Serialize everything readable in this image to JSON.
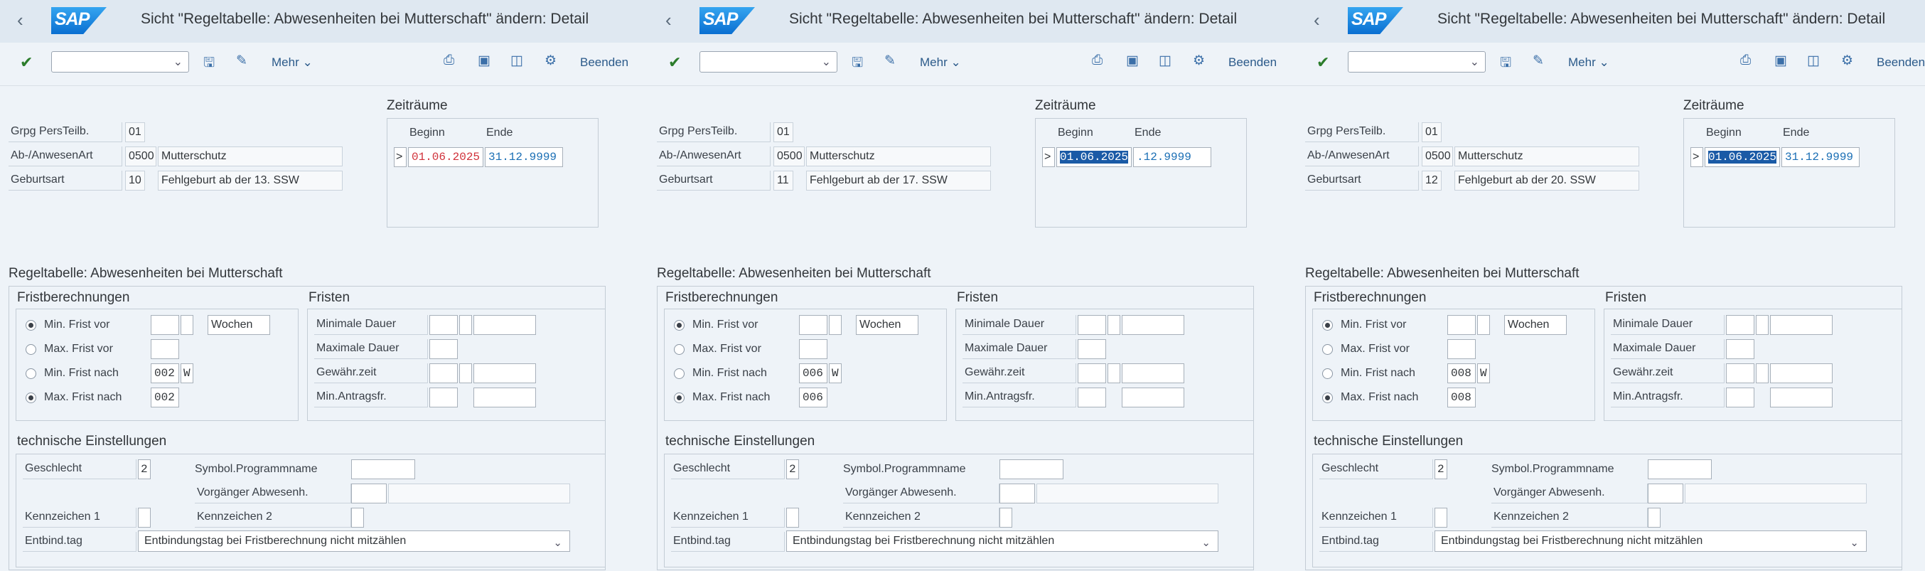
{
  "app": {
    "window_title": "Sicht \"Regeltabelle: Abwesenheiten bei Mutterschaft\" ändern: Detail",
    "logo_text": "SAP",
    "toolbar": {
      "more_label": "Mehr",
      "exit_label": "Beenden",
      "command_field_value": ""
    }
  },
  "labels": {
    "grpg": "Grpg PersTeilb.",
    "absence_type": "Ab-/AnwesenArt",
    "birth_type": "Geburtsart",
    "periods_title": "Zeiträume",
    "begin": "Beginn",
    "end": "Ende",
    "section_title": "Regeltabelle: Abwesenheiten bei Mutterschaft",
    "calc_title": "Fristberechnungen",
    "min_before": "Min. Frist vor",
    "max_before": "Max. Frist vor",
    "min_after": "Min. Frist nach",
    "max_after": "Max. Frist nach",
    "deadlines_title": "Fristen",
    "min_duration": "Minimale Dauer",
    "max_duration": "Maximale Dauer",
    "grant_time": "Gewähr.zeit",
    "min_application": "Min.Antragsfr.",
    "tech_title": "technische Einstellungen",
    "gender": "Geschlecht",
    "symbolic_program": "Symbol.Programmname",
    "previous_absence": "Vorgänger Abwesenh.",
    "indicator1": "Kennzeichen 1",
    "indicator2": "Kennzeichen 2",
    "delivery_day": "Entbind.tag"
  },
  "panes": [
    {
      "grpg": "01",
      "absence_code": "0500",
      "absence_text": "Mutterschutz",
      "birth_code": "10",
      "birth_text": "Fehlgeburt ab der 13. SSW",
      "begin": "01.06.2025",
      "end": "31.12.9999",
      "row_marker": ">",
      "min_before_unit": "Wochen",
      "min_after_value": "002",
      "min_after_flag": "W",
      "max_after_value": "002",
      "gender": "2",
      "delivery_option": "Entbindungstag bei Fristberechnung nicht mitzählen"
    },
    {
      "grpg": "01",
      "absence_code": "0500",
      "absence_text": "Mutterschutz",
      "birth_code": "11",
      "birth_text": "Fehlgeburt ab der 17. SSW",
      "begin": "01.06.2025",
      "end": ".12.9999",
      "row_marker": ">",
      "min_before_unit": "Wochen",
      "min_after_value": "006",
      "min_after_flag": "W",
      "max_after_value": "006",
      "gender": "2",
      "delivery_option": "Entbindungstag bei Fristberechnung nicht mitzählen"
    },
    {
      "grpg": "01",
      "absence_code": "0500",
      "absence_text": "Mutterschutz",
      "birth_code": "12",
      "birth_text": "Fehlgeburt ab der 20. SSW",
      "begin": "01.06.2025",
      "end": "31.12.9999",
      "row_marker": ">",
      "min_before_unit": "Wochen",
      "min_after_value": "008",
      "min_after_flag": "W",
      "max_after_value": "008",
      "gender": "2",
      "delivery_option": "Entbindungstag bei Fristberechnung nicht mitzählen"
    }
  ]
}
